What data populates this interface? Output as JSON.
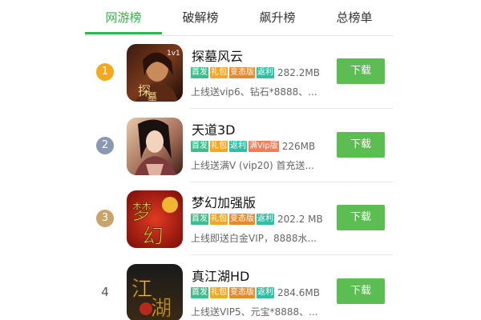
{
  "tabs": [
    {
      "label": "网游榜",
      "active": true
    },
    {
      "label": "破解榜",
      "active": false
    },
    {
      "label": "飙升榜",
      "active": false
    },
    {
      "label": "总榜单",
      "active": false
    }
  ],
  "colors": {
    "accent": "#35b54a",
    "download_button": "#5cbd52",
    "tag_shoufa": "#3cbf8c",
    "tag_libao": "#f0a826",
    "tag_biantai": "#e88a2a",
    "tag_fanli": "#2fbfa4",
    "tag_vip": "#ef7d5a",
    "rank_1": "#f3a91b",
    "rank_2": "#8a98b0",
    "rank_3": "#c9a36a"
  },
  "apps": [
    {
      "rank": "1",
      "name": "探墓风云",
      "icon": "tanmu-fengyun-app-icon",
      "tags": [
        "首发",
        "礼包",
        "变态版",
        "返利"
      ],
      "size": "282.2MB",
      "description": "上线送vip6、钻石*8888、...",
      "download_label": "下载"
    },
    {
      "rank": "2",
      "name": "天道3D",
      "icon": "tiandao-3d-app-icon",
      "tags": [
        "首发",
        "礼包",
        "返利",
        "满Vip版"
      ],
      "size": "226MB",
      "description": "上线送满V (vip20) 首充送...",
      "download_label": "下载"
    },
    {
      "rank": "3",
      "name": "梦幻加强版",
      "icon": "menghuan-jiaqiang-app-icon",
      "tags": [
        "首发",
        "礼包",
        "变态版",
        "返利"
      ],
      "size": "202.2 MB",
      "description": "上线即送白金VIP，8888水...",
      "download_label": "下载"
    },
    {
      "rank": "4",
      "name": "真江湖HD",
      "icon": "zhen-jianghu-hd-app-icon",
      "tags": [
        "首发",
        "礼包",
        "变态版",
        "返利"
      ],
      "size": "284.6MB",
      "description": "上线送VIP5、元宝*8888、...",
      "download_label": "下载"
    }
  ]
}
